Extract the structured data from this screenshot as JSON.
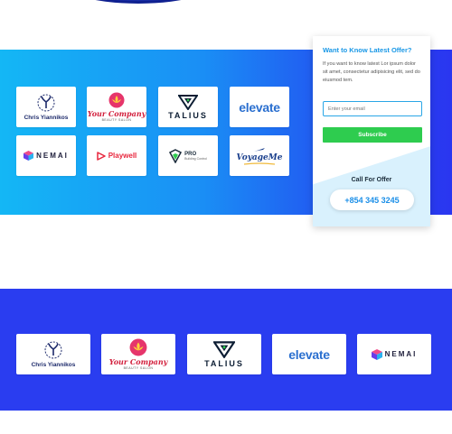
{
  "colors": {
    "hero_start": "#14b7f5",
    "hero_end": "#2a36f0",
    "band": "#2a3df0",
    "accent_blue": "#1897e6",
    "button_green": "#2ecc4f"
  },
  "logos": {
    "chris": {
      "label": "Chris Yiannikos"
    },
    "your_company": {
      "label": "Your Company",
      "sub": "BEAUTY SALON"
    },
    "talius": {
      "label": "TALIUS"
    },
    "elevate": {
      "label": "elevate"
    },
    "nemai": {
      "label": "NEMAI"
    },
    "playwell": {
      "label": "Playwell"
    },
    "pro": {
      "label": "PRO",
      "sub": "Building Control"
    },
    "voyage": {
      "label": "VoyageMe"
    }
  },
  "offer": {
    "title": "Want to Know Latest Offer?",
    "body": "If you want to know latest Lor ipsum dolor sit amet, consectetur adipisicing elit, sed do eiusmod tem.",
    "email_placeholder": "Enter your email",
    "subscribe_label": "Subscribe",
    "call_label": "Call For Offer",
    "phone": "+854 345 3245"
  }
}
